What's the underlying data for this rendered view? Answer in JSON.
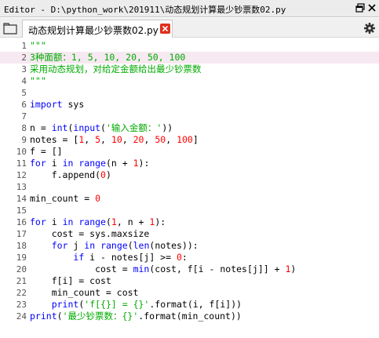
{
  "window": {
    "title": "Editor - D:\\python_work\\201911\\动态规划计算最少钞票数02.py"
  },
  "tabs": [
    {
      "label": "动态规划计算最少钞票数02.py",
      "active": true
    }
  ],
  "icons": {
    "browse": "folder-tab-icon",
    "undock": "undock-icon",
    "close_window": "close-icon",
    "close_tab": "close-tab-icon",
    "options": "gear-icon"
  },
  "editor": {
    "current_line": 2,
    "colors": {
      "keyword": "#0000ff",
      "string": "#00aa00",
      "number": "#ff0000",
      "builtin": "#900090",
      "current_line_bg": "#f7e9f1",
      "tab_close": "#e0301e"
    },
    "lines": [
      {
        "n": "1",
        "text": "\"\"\""
      },
      {
        "n": "2",
        "text": "3种面额：1, 5, 10, 20, 50, 100"
      },
      {
        "n": "3",
        "text": "采用动态规划，对给定金额给出最少钞票数"
      },
      {
        "n": "4",
        "text": "\"\"\""
      },
      {
        "n": "5",
        "text": ""
      },
      {
        "n": "6",
        "text": "import sys"
      },
      {
        "n": "7",
        "text": ""
      },
      {
        "n": "8",
        "text": "n = int(input('输入金额：'))"
      },
      {
        "n": "9",
        "text": "notes = [1, 5, 10, 20, 50, 100]"
      },
      {
        "n": "10",
        "text": "f = []"
      },
      {
        "n": "11",
        "text": "for i in range(n + 1):"
      },
      {
        "n": "12",
        "text": "    f.append(0)"
      },
      {
        "n": "13",
        "text": ""
      },
      {
        "n": "14",
        "text": "min_count = 0"
      },
      {
        "n": "15",
        "text": ""
      },
      {
        "n": "16",
        "text": "for i in range(1, n + 1):"
      },
      {
        "n": "17",
        "text": "    cost = sys.maxsize"
      },
      {
        "n": "18",
        "text": "    for j in range(len(notes)):"
      },
      {
        "n": "19",
        "text": "        if i - notes[j] >= 0:"
      },
      {
        "n": "20",
        "text": "            cost = min(cost, f[i - notes[j]] + 1)"
      },
      {
        "n": "21",
        "text": "    f[i] = cost"
      },
      {
        "n": "22",
        "text": "    min_count = cost"
      },
      {
        "n": "23",
        "text": "    print('f[{}] = {}'.format(i, f[i]))"
      },
      {
        "n": "24",
        "text": "print('最少钞票数：{}'.format(min_count))"
      }
    ]
  }
}
